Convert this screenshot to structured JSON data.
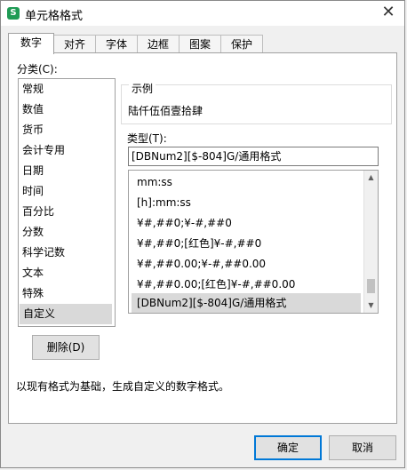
{
  "window": {
    "title": "单元格格式",
    "app_icon_letter": "S"
  },
  "tabs": [
    {
      "label": "数字",
      "active": true
    },
    {
      "label": "对齐",
      "active": false
    },
    {
      "label": "字体",
      "active": false
    },
    {
      "label": "边框",
      "active": false
    },
    {
      "label": "图案",
      "active": false
    },
    {
      "label": "保护",
      "active": false
    }
  ],
  "category": {
    "label": "分类(C):",
    "items": [
      "常规",
      "数值",
      "货币",
      "会计专用",
      "日期",
      "时间",
      "百分比",
      "分数",
      "科学记数",
      "文本",
      "特殊",
      "自定义"
    ],
    "selected": "自定义"
  },
  "sample": {
    "legend": "示例",
    "value": "陆仟伍佰壹拾肆"
  },
  "type": {
    "label": "类型(T):",
    "value": "[DBNum2][$-804]G/通用格式",
    "list": [
      "mm:ss",
      "[h]:mm:ss",
      "¥#,##0;¥-#,##0",
      "¥#,##0;[红色]¥-#,##0",
      "¥#,##0.00;¥-#,##0.00",
      "¥#,##0.00;[红色]¥-#,##0.00",
      "[DBNum2][$-804]G/通用格式"
    ],
    "selected_index": 6,
    "scroll_position": 0.95
  },
  "buttons": {
    "delete": "删除(D)",
    "ok": "确定",
    "cancel": "取消"
  },
  "description": "以现有格式为基础，生成自定义的数字格式。",
  "colors": {
    "accent": "#0078d7",
    "app_icon": "#1f9b55",
    "selection": "#d9d9d9"
  }
}
